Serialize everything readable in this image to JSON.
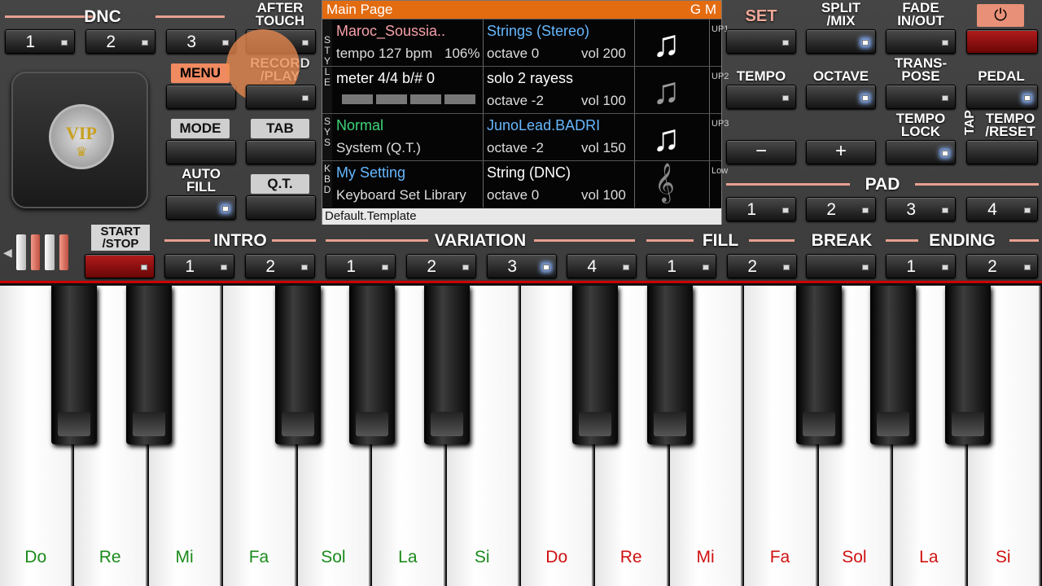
{
  "dnc": {
    "label": "DNC",
    "buttons": [
      "1",
      "2",
      "3"
    ]
  },
  "after_touch": {
    "label": "AFTER\nTOUCH"
  },
  "record": {
    "label": "RECORD\n/PLAY",
    "overlay": "0"
  },
  "menu": {
    "label": "MENU"
  },
  "mode": {
    "label": "MODE"
  },
  "tab": {
    "label": "TAB"
  },
  "auto_fill": {
    "label": "AUTO\nFILL"
  },
  "qt": {
    "label": "Q.T."
  },
  "vip": {
    "label": "VIP"
  },
  "start_stop": {
    "label": "START\n/STOP"
  },
  "intro": {
    "label": "INTRO",
    "buttons": [
      "1",
      "2"
    ]
  },
  "variation": {
    "label": "VARIATION",
    "buttons": [
      "1",
      "2",
      "3",
      "4"
    ]
  },
  "fill": {
    "label": "FILL",
    "buttons": [
      "1",
      "2"
    ]
  },
  "break": {
    "label": "BREAK"
  },
  "ending": {
    "label": "ENDING",
    "buttons": [
      "1",
      "2"
    ]
  },
  "lcd": {
    "title": "Main Page",
    "gm": "G M",
    "footer": "Default.Template",
    "side_left": [
      "S",
      "T",
      "Y",
      "L",
      "E",
      "S",
      "Y",
      "S",
      "K",
      "B",
      "D"
    ],
    "rows": [
      {
        "left1": "Maroc_Soussia..",
        "left2": "tempo 127 bpm",
        "left2b": "106%",
        "right1": "Strings (Stereo)",
        "octave": "octave  0",
        "vol": "vol 200",
        "side": "UP1"
      },
      {
        "left1": "meter 4/4  b/#  0",
        "left2": "",
        "right1": "solo 2 rayess",
        "octave": "octave -2",
        "vol": "vol 100",
        "side": "UP2"
      },
      {
        "left1": "Normal",
        "left2": "System (Q.T.)",
        "right1": "JunoLead.BADRI",
        "octave": "octave -2",
        "vol": "vol 150",
        "side": "UP3"
      },
      {
        "left1": "My Setting",
        "left2": "Keyboard Set Library",
        "right1": "String (DNC)",
        "octave": "octave  0",
        "vol": "vol 100",
        "side": "Low"
      }
    ]
  },
  "right_panel": {
    "set": "SET",
    "split": "SPLIT\n/MIX",
    "fade": "FADE\nIN/OUT",
    "power": "⏻",
    "tempo": "TEMPO",
    "octave": "OCTAVE",
    "transpose": "TRANS-\nPOSE",
    "pedal": "PEDAL",
    "tempo_lock": "TEMPO\nLOCK",
    "tap": "TAP",
    "tempo_reset": "TEMPO\n/RESET",
    "minus": "−",
    "plus": "+",
    "pad": "PAD",
    "pad_buttons": [
      "1",
      "2",
      "3",
      "4"
    ]
  },
  "keyboard": {
    "white_notes": [
      "Do",
      "Re",
      "Mi",
      "Fa",
      "Sol",
      "La",
      "Si",
      "Do",
      "Re",
      "Mi",
      "Fa",
      "Sol",
      "La",
      "Si"
    ],
    "note_colors": [
      "#1a8a1a",
      "#d01010"
    ]
  }
}
